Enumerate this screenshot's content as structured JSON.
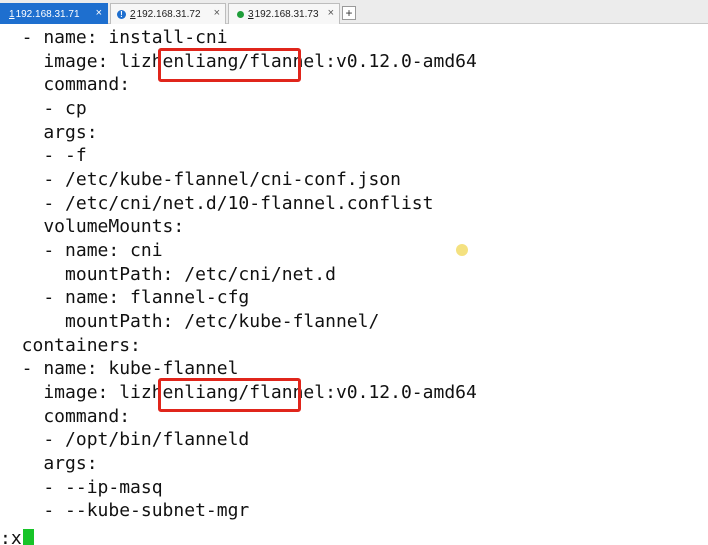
{
  "tabs": [
    {
      "num": "1",
      "host": "192.168.31.71",
      "active": true,
      "close": "×"
    },
    {
      "num": "2",
      "host": "192.168.31.72",
      "active": false,
      "status": "warning",
      "close": "×"
    },
    {
      "num": "3",
      "host": "192.168.31.73",
      "active": false,
      "status": "connected",
      "close": "×"
    }
  ],
  "add_tab_label": "+",
  "terminal": {
    "lines": [
      "  - name: install-cni",
      "    image: lizhenliang/flannel:v0.12.0-amd64",
      "    command:",
      "    - cp",
      "    args:",
      "    - -f",
      "    - /etc/kube-flannel/cni-conf.json",
      "    - /etc/cni/net.d/10-flannel.conflist",
      "    volumeMounts:",
      "    - name: cni",
      "      mountPath: /etc/cni/net.d",
      "    - name: flannel-cfg",
      "      mountPath: /etc/kube-flannel/",
      "  containers:",
      "  - name: kube-flannel",
      "    image: lizhenliang/flannel:v0.12.0-amd64",
      "    command:",
      "    - /opt/bin/flanneld",
      "    args:",
      "    - --ip-masq",
      "    - --kube-subnet-mgr"
    ],
    "prompt": ":x"
  },
  "colors": {
    "tab_active": "#1e6fcf",
    "highlight": "#e0251b",
    "cursor": "#17c428"
  },
  "icons": {
    "tab2_status": "info-warning-icon",
    "tab3_status": "connected-dot-icon"
  }
}
